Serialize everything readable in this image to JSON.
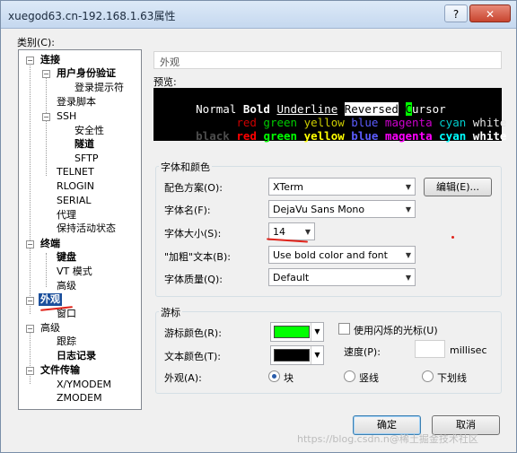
{
  "window": {
    "title": "xuegod63.cn-192.168.1.63属性",
    "help_label": "?",
    "close_label": "✕"
  },
  "category_label": "类别(C):",
  "tree": {
    "conn": "连接",
    "auth": "用户身份验证",
    "login_prompt": "登录提示符",
    "login_script": "登录脚本",
    "ssh": "SSH",
    "security": "安全性",
    "tunnel": "隧道",
    "sftp": "SFTP",
    "telnet": "TELNET",
    "rlogin": "RLOGIN",
    "serial": "SERIAL",
    "proxy": "代理",
    "keepalive": "保持活动状态",
    "terminal": "终端",
    "keyboard": "键盘",
    "vt_mode": "VT 模式",
    "advanced1": "高级",
    "appearance": "外观",
    "window": "窗口",
    "advanced2": "高级",
    "trace": "跟踪",
    "logging": "日志记录",
    "file_transfer": "文件传输",
    "xymodem": "X/YMODEM",
    "zmodem": "ZMODEM"
  },
  "panel_title": "外观",
  "preview": {
    "label": "预览:",
    "row1": [
      "Normal",
      "Bold",
      "Underline",
      "Reversed",
      "C",
      "ursor"
    ],
    "row2": [
      "red",
      "green",
      "yellow",
      "blue",
      "magenta",
      "cyan",
      "white"
    ],
    "row3": [
      "black",
      "red",
      "green",
      "yellow",
      "blue",
      "magenta",
      "cyan",
      "white"
    ]
  },
  "colors": {
    "accent": "#1b4f9c",
    "annotation": "#e0241b",
    "cursor_color": "#00ff00",
    "text_color": "#000000"
  },
  "font_group": {
    "title": "字体和颜色",
    "scheme_label": "配色方案(O):",
    "scheme_value": "XTerm",
    "edit_button": "编辑(E)...",
    "font_label": "字体名(F):",
    "font_value": "DejaVu Sans Mono",
    "size_label": "字体大小(S):",
    "size_value": "14",
    "bold_label": "\"加粗\"文本(B):",
    "bold_value": "Use bold color and font",
    "quality_label": "字体质量(Q):",
    "quality_value": "Default"
  },
  "cursor_group": {
    "title": "游标",
    "cursor_color_label": "游标颜色(R):",
    "text_color_label": "文本颜色(T):",
    "blink_label": "使用闪烁的光标(U)",
    "speed_label": "速度(P):",
    "speed_unit": "millisec",
    "shape_label": "外观(A):",
    "shape_block": "块",
    "shape_vline": "竖线",
    "shape_underline": "下划线"
  },
  "buttons": {
    "ok": "确定",
    "cancel": "取消"
  },
  "watermark": "https://blog.csdn.n@稀土掘金技术社区"
}
